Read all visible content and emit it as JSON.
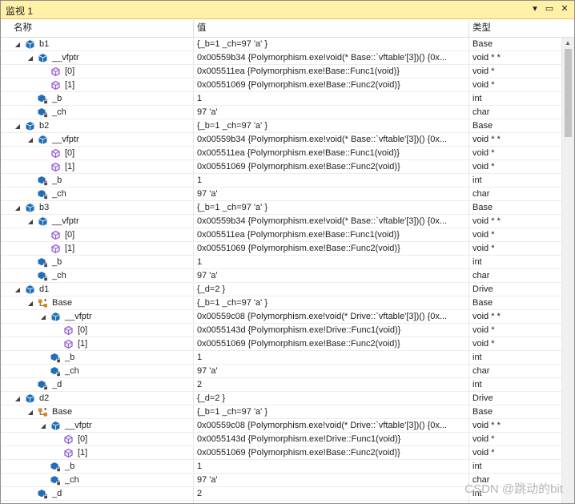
{
  "window": {
    "title": "监视 1",
    "buttons": {
      "dropdown": "▾",
      "restore": "▭",
      "close": "✕"
    }
  },
  "columns": {
    "name": "名称",
    "value": "值",
    "type": "类型"
  },
  "rows": [
    {
      "d": 0,
      "arrow": "expanded",
      "icon": "object",
      "name": "b1",
      "value": "{_b=1 _ch=97 'a' }",
      "type": "Base"
    },
    {
      "d": 1,
      "arrow": "expanded",
      "icon": "object",
      "name": "__vfptr",
      "value": "0x00559b34 {Polymorphism.exe!void(* Base::`vftable'[3])() {0x...",
      "type": "void * *"
    },
    {
      "d": 2,
      "arrow": "none",
      "icon": "method",
      "name": "[0]",
      "value": "0x005511ea {Polymorphism.exe!Base::Func1(void)}",
      "type": "void *"
    },
    {
      "d": 2,
      "arrow": "none",
      "icon": "method",
      "name": "[1]",
      "value": "0x00551069 {Polymorphism.exe!Base::Func2(void)}",
      "type": "void *"
    },
    {
      "d": 1,
      "arrow": "none",
      "icon": "field",
      "name": "_b",
      "value": "1",
      "type": "int"
    },
    {
      "d": 1,
      "arrow": "none",
      "icon": "field",
      "name": "_ch",
      "value": "97 'a'",
      "type": "char"
    },
    {
      "d": 0,
      "arrow": "expanded",
      "icon": "object",
      "name": "b2",
      "value": "{_b=1 _ch=97 'a' }",
      "type": "Base"
    },
    {
      "d": 1,
      "arrow": "expanded",
      "icon": "object",
      "name": "__vfptr",
      "value": "0x00559b34 {Polymorphism.exe!void(* Base::`vftable'[3])() {0x...",
      "type": "void * *"
    },
    {
      "d": 2,
      "arrow": "none",
      "icon": "method",
      "name": "[0]",
      "value": "0x005511ea {Polymorphism.exe!Base::Func1(void)}",
      "type": "void *"
    },
    {
      "d": 2,
      "arrow": "none",
      "icon": "method",
      "name": "[1]",
      "value": "0x00551069 {Polymorphism.exe!Base::Func2(void)}",
      "type": "void *"
    },
    {
      "d": 1,
      "arrow": "none",
      "icon": "field",
      "name": "_b",
      "value": "1",
      "type": "int"
    },
    {
      "d": 1,
      "arrow": "none",
      "icon": "field",
      "name": "_ch",
      "value": "97 'a'",
      "type": "char"
    },
    {
      "d": 0,
      "arrow": "expanded",
      "icon": "object",
      "name": "b3",
      "value": "{_b=1 _ch=97 'a' }",
      "type": "Base"
    },
    {
      "d": 1,
      "arrow": "expanded",
      "icon": "object",
      "name": "__vfptr",
      "value": "0x00559b34 {Polymorphism.exe!void(* Base::`vftable'[3])() {0x...",
      "type": "void * *"
    },
    {
      "d": 2,
      "arrow": "none",
      "icon": "method",
      "name": "[0]",
      "value": "0x005511ea {Polymorphism.exe!Base::Func1(void)}",
      "type": "void *"
    },
    {
      "d": 2,
      "arrow": "none",
      "icon": "method",
      "name": "[1]",
      "value": "0x00551069 {Polymorphism.exe!Base::Func2(void)}",
      "type": "void *"
    },
    {
      "d": 1,
      "arrow": "none",
      "icon": "field",
      "name": "_b",
      "value": "1",
      "type": "int"
    },
    {
      "d": 1,
      "arrow": "none",
      "icon": "field",
      "name": "_ch",
      "value": "97 'a'",
      "type": "char"
    },
    {
      "d": 0,
      "arrow": "expanded",
      "icon": "object",
      "name": "d1",
      "value": "{_d=2 }",
      "type": "Drive"
    },
    {
      "d": 1,
      "arrow": "expanded",
      "icon": "base-class",
      "name": "Base",
      "value": "{_b=1 _ch=97 'a' }",
      "type": "Base"
    },
    {
      "d": 2,
      "arrow": "expanded",
      "icon": "object",
      "name": "__vfptr",
      "value": "0x00559c08 {Polymorphism.exe!void(* Drive::`vftable'[3])() {0x...",
      "type": "void * *"
    },
    {
      "d": 3,
      "arrow": "none",
      "icon": "method",
      "name": "[0]",
      "value": "0x0055143d {Polymorphism.exe!Drive::Func1(void)}",
      "type": "void *"
    },
    {
      "d": 3,
      "arrow": "none",
      "icon": "method",
      "name": "[1]",
      "value": "0x00551069 {Polymorphism.exe!Base::Func2(void)}",
      "type": "void *"
    },
    {
      "d": 2,
      "arrow": "none",
      "icon": "field",
      "name": "_b",
      "value": "1",
      "type": "int"
    },
    {
      "d": 2,
      "arrow": "none",
      "icon": "field",
      "name": "_ch",
      "value": "97 'a'",
      "type": "char"
    },
    {
      "d": 1,
      "arrow": "none",
      "icon": "field",
      "name": "_d",
      "value": "2",
      "type": "int"
    },
    {
      "d": 0,
      "arrow": "expanded",
      "icon": "object",
      "name": "d2",
      "value": "{_d=2 }",
      "type": "Drive"
    },
    {
      "d": 1,
      "arrow": "expanded",
      "icon": "base-class",
      "name": "Base",
      "value": "{_b=1 _ch=97 'a' }",
      "type": "Base"
    },
    {
      "d": 2,
      "arrow": "expanded",
      "icon": "object",
      "name": "__vfptr",
      "value": "0x00559c08 {Polymorphism.exe!void(* Drive::`vftable'[3])() {0x...",
      "type": "void * *"
    },
    {
      "d": 3,
      "arrow": "none",
      "icon": "method",
      "name": "[0]",
      "value": "0x0055143d {Polymorphism.exe!Drive::Func1(void)}",
      "type": "void *"
    },
    {
      "d": 3,
      "arrow": "none",
      "icon": "method",
      "name": "[1]",
      "value": "0x00551069 {Polymorphism.exe!Base::Func2(void)}",
      "type": "void *"
    },
    {
      "d": 2,
      "arrow": "none",
      "icon": "field",
      "name": "_b",
      "value": "1",
      "type": "int"
    },
    {
      "d": 2,
      "arrow": "none",
      "icon": "field",
      "name": "_ch",
      "value": "97 'a'",
      "type": "char"
    },
    {
      "d": 1,
      "arrow": "none",
      "icon": "field",
      "name": "_d",
      "value": "2",
      "type": "int"
    }
  ],
  "watermark": "CSDN @跳动的bit",
  "colors": {
    "titlebar": "#fff2a8",
    "object_icon": "#1e6fb8",
    "method_icon": "#8a5ac7",
    "base_icon": "#d58a1a"
  }
}
